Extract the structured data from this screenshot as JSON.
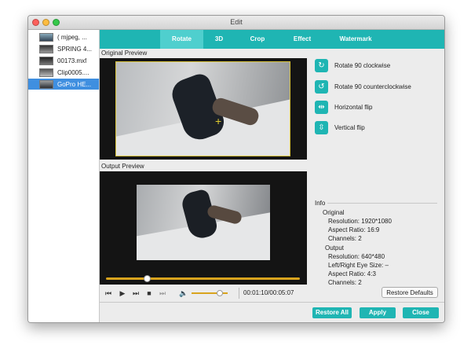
{
  "window": {
    "title": "Edit"
  },
  "files": [
    {
      "name": "( mjpeg, ...",
      "selected": false
    },
    {
      "name": "SPRING 4...",
      "selected": false
    },
    {
      "name": "00173.mxf",
      "selected": false
    },
    {
      "name": "Clip0005....",
      "selected": false
    },
    {
      "name": "GoPro HE...",
      "selected": true
    }
  ],
  "tabs": [
    {
      "label": "Rotate",
      "active": true
    },
    {
      "label": "3D",
      "active": false
    },
    {
      "label": "Crop",
      "active": false
    },
    {
      "label": "Effect",
      "active": false
    },
    {
      "label": "Watermark",
      "active": false
    }
  ],
  "preview": {
    "original_label": "Original Preview",
    "output_label": "Output Preview",
    "crosshair": "+"
  },
  "player": {
    "seek_fraction": 0.21,
    "volume_fraction": 0.78,
    "time": "00:01:10/00:05:07",
    "icons": [
      "prev-frame-icon",
      "play-icon",
      "next-frame-icon",
      "stop-icon",
      "skip-end-icon",
      "volume-icon"
    ]
  },
  "actions": [
    {
      "label": "Rotate 90 clockwise",
      "icon": "rotate-cw-icon",
      "glyph": "↻"
    },
    {
      "label": "Rotate 90 counterclockwise",
      "icon": "rotate-ccw-icon",
      "glyph": "↺"
    },
    {
      "label": "Horizontal flip",
      "icon": "flip-horizontal-icon",
      "glyph": "⇹"
    },
    {
      "label": "Vertical flip",
      "icon": "flip-vertical-icon",
      "glyph": "⇳"
    }
  ],
  "info": {
    "heading": "Info",
    "original_heading": "Original",
    "original": {
      "resolution": "Resolution: 1920*1080",
      "aspect": "Aspect Ratio: 16:9",
      "channels": "Channels: 2"
    },
    "output_heading": "Output",
    "output": {
      "resolution": "Resolution: 640*480",
      "eye_size": "Left/Right Eye Size: –",
      "aspect": "Aspect Ratio: 4:3",
      "channels": "Channels: 2"
    }
  },
  "buttons": {
    "restore_defaults": "Restore Defaults",
    "restore_all": "Restore All",
    "apply": "Apply",
    "close": "Close"
  },
  "colors": {
    "accent": "#1fb5b3",
    "selection": "#3f8fe0",
    "progress": "#d9a41e"
  }
}
